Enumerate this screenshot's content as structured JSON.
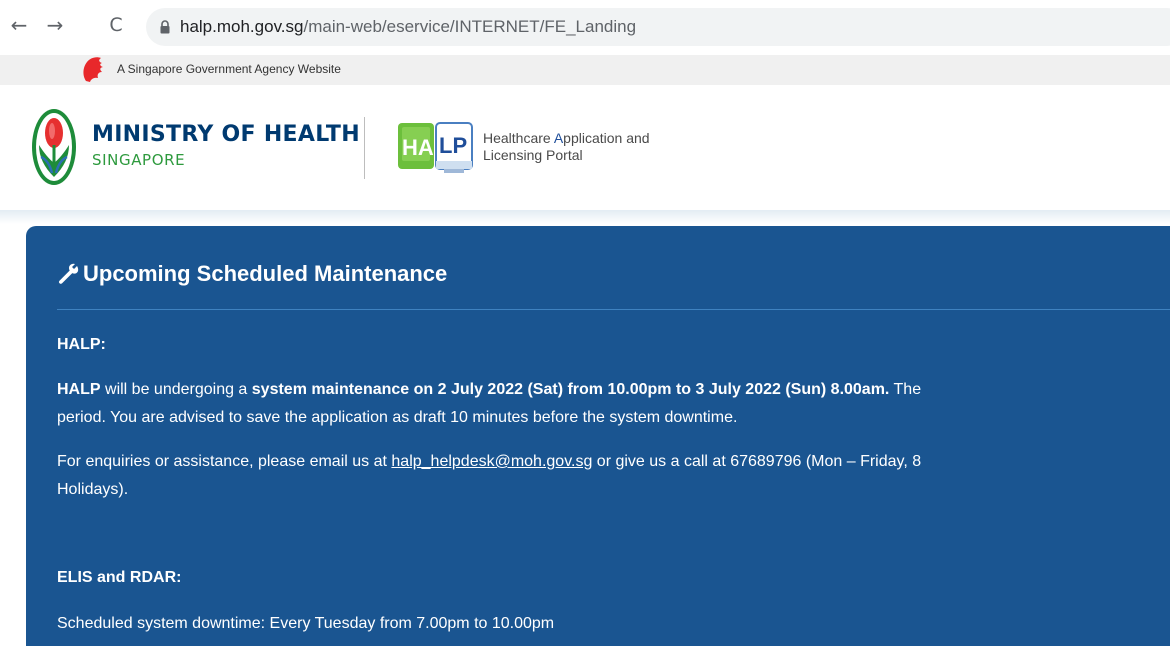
{
  "browser": {
    "url_domain": "halp.moh.gov.sg",
    "url_path": "/main-web/eservice/INTERNET/FE_Landing",
    "back_glyph": "←",
    "forward_glyph": "→",
    "reload_glyph": "C"
  },
  "masthead": {
    "text": "A Singapore Government Agency Website"
  },
  "header": {
    "moh_name": "MINISTRY OF HEALTH",
    "moh_sub": "SINGAPORE",
    "halp_tag_p1": "Healthcare ",
    "halp_tag_hl": "A",
    "halp_tag_p2": "pplication and",
    "halp_tag_line2": "Licensing Portal"
  },
  "notice": {
    "title": "Upcoming Scheduled Maintenance",
    "halp_heading": "HALP:",
    "line1_a": "HALP",
    "line1_b": " will be undergoing a ",
    "line1_c": "system maintenance on 2 July 2022 (Sat) from 10.00pm to 3 July 2022 (Sun) 8.00am.",
    "line1_d": " The",
    "line2": "period. You are advised to save the application as draft 10 minutes before the system downtime.",
    "line3_a": "For enquiries or assistance, please email us at ",
    "line3_link": "halp_helpdesk@moh.gov.sg",
    "line3_b": " or give us a call at 67689796 (Mon – Friday, 8",
    "line4": "Holidays).",
    "elis_heading": "ELIS and RDAR:",
    "elis_line": "Scheduled system downtime: Every Tuesday from 7.00pm to 10.00pm"
  },
  "colors": {
    "panel_bg": "#1a5591",
    "moh_navy": "#003a70",
    "moh_green": "#2e9a3e"
  },
  "icons": [
    "back-arrow-icon",
    "forward-arrow-icon",
    "reload-icon",
    "lock-icon",
    "lion-head-icon",
    "moh-logo-icon",
    "halp-logo-icon",
    "wrench-icon"
  ]
}
